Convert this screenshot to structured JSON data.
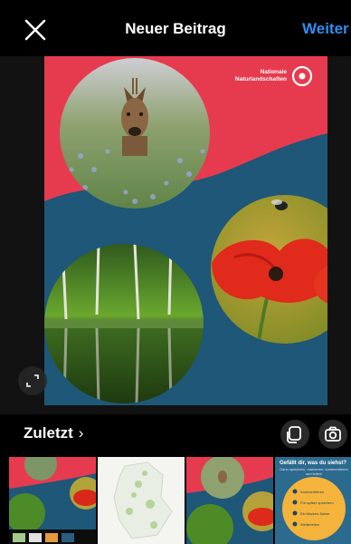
{
  "topbar": {
    "title": "Neuer Beitrag",
    "next_label": "Weiter",
    "close_icon": "close-icon",
    "accent_color": "#2f8ef0"
  },
  "poster": {
    "brand_line1": "Nationale",
    "brand_line2": "Naturlandschaften",
    "colors": {
      "red": "#e63b4f",
      "blue": "#1e5778",
      "bg": "#121212"
    }
  },
  "gallery": {
    "album_label": "Zuletzt",
    "chevron": "›",
    "multi_select_icon": "multi-select-icon",
    "camera_icon": "camera-icon",
    "expand_icon": "expand-icon",
    "thumbnails": [
      {
        "name": "thumb-poster-screenshot"
      },
      {
        "name": "thumb-map"
      },
      {
        "name": "thumb-poster"
      },
      {
        "name": "thumb-survey",
        "heading": "Gefällt dir, was du siehst?",
        "subtext": "Dann speichern, markieren, kommentieren und teilen!",
        "items": [
          "Kommentieren",
          "Für später speichern",
          "Ein Marken-Name",
          "Weiterteilen"
        ]
      }
    ]
  }
}
